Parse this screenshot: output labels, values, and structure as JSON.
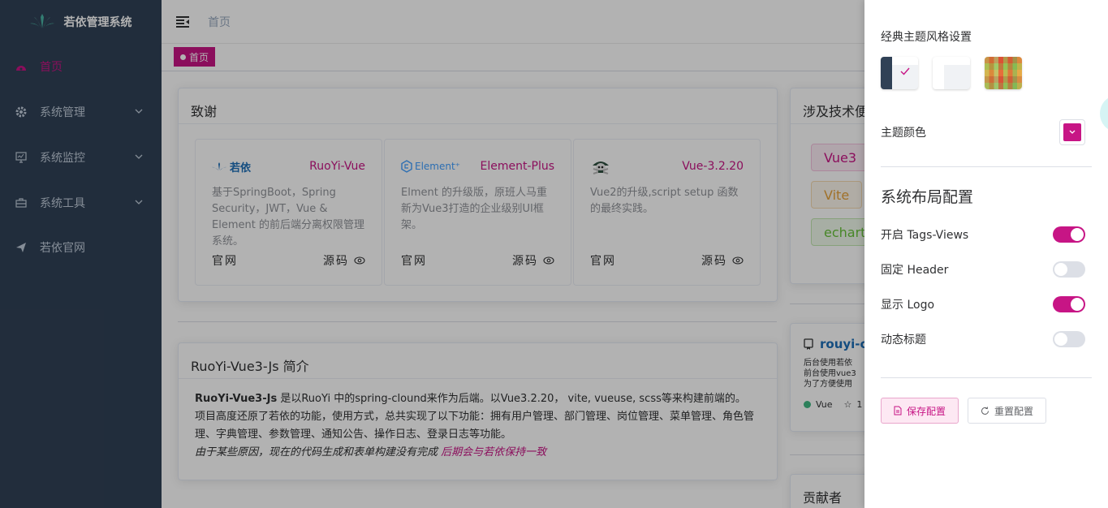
{
  "sidebar": {
    "title": "若依管理系统",
    "items": [
      {
        "label": "首页",
        "icon": "dashboard-icon",
        "active": true
      },
      {
        "label": "系统管理",
        "icon": "gear-icon"
      },
      {
        "label": "系统监控",
        "icon": "monitor-icon"
      },
      {
        "label": "系统工具",
        "icon": "toolbox-icon"
      },
      {
        "label": "若依官网",
        "icon": "send-icon"
      }
    ]
  },
  "navbar": {
    "breadcrumb": "首页"
  },
  "tags": {
    "active": "首页"
  },
  "thanks": {
    "title": "致谢",
    "projects": [
      {
        "logo_text": "若依",
        "name": "RuoYi-Vue",
        "desc": "基于SpringBoot，Spring Security，JWT，Vue & Element 的前后端分离权限管理系统。",
        "site": "官网",
        "source": "源码"
      },
      {
        "logo_text": "Element⁺",
        "name": "Element-Plus",
        "desc": "Elment 的升级版，原班人马重新为Vue3打造的企业级别UI框架。",
        "site": "官网",
        "source": "源码"
      },
      {
        "logo_text": "",
        "name": "Vue-3.2.20",
        "desc": "Vue2的升级,script setup 函数的最终实践。",
        "site": "官网",
        "source": "源码"
      }
    ]
  },
  "tech": {
    "title": "涉及技术便",
    "tags": [
      "Vue3",
      "Vite",
      "echarts"
    ]
  },
  "intro": {
    "title": "RuoYi-Vue3-Js 简介",
    "name": "RuoYi-Vue3-Js",
    "line1": " 是以RuoYi 中的spring-clound来作为后端。以Vue3.2.20， vite, vueuse, scss等来构建前端的。",
    "line2": "项目高度还原了若依的功能，使用方式，总共实现了以下功能：拥有用户管理、部门管理、岗位管理、菜单管理、角色管理、字典管理、参数管理、通知公告、操作日志、登录日志等功能。",
    "note": "由于某些原因，现在的代码生成和表单构建没有完成",
    "note_highlight": "后期会与若依保持一致"
  },
  "repo": {
    "name": "rouyi-c",
    "desc1": "后台使用若依",
    "desc2": "前台使用vue3",
    "desc3": "为了方便使用",
    "lang": "Vue",
    "stars": "1"
  },
  "contrib": {
    "title": "贡献者"
  },
  "settings": {
    "style_title": "经典主题风格设置",
    "theme_color_label": "主题颜色",
    "layout_title": "系统布局配置",
    "toggles": [
      {
        "label": "开启 Tags-Views",
        "on": true
      },
      {
        "label": "固定 Header",
        "on": false
      },
      {
        "label": "显示 Logo",
        "on": true
      },
      {
        "label": "动态标题",
        "on": false
      }
    ],
    "save_label": "保存配置",
    "reset_label": "重置配置",
    "accent": "#c71585"
  }
}
